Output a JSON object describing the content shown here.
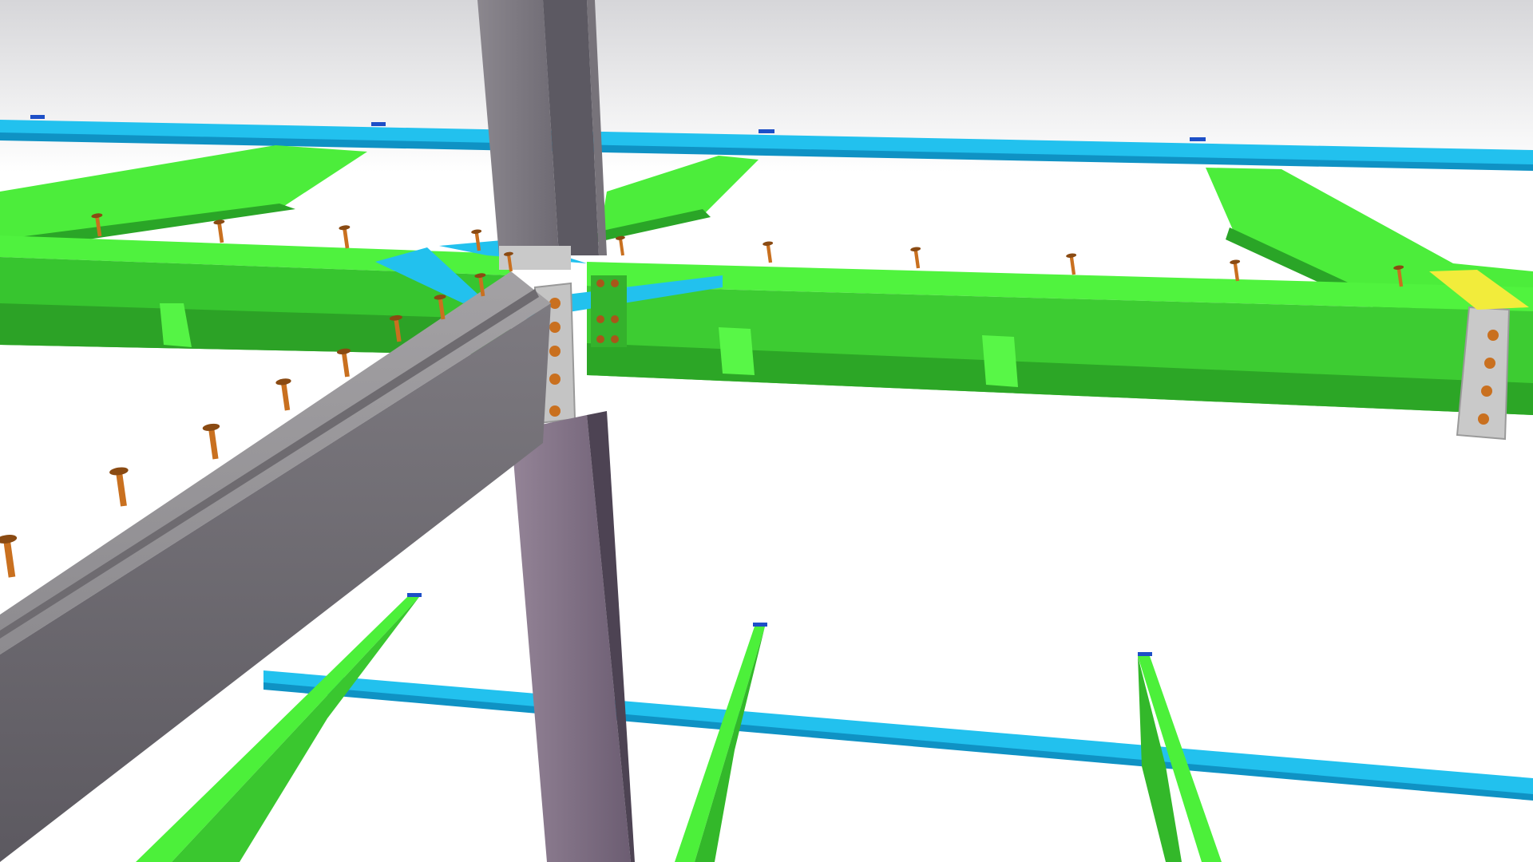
{
  "scene": {
    "kind": "3d-structural-steel-render",
    "colors": {
      "sky_top": "#d9d9dc",
      "sky_bottom": "#ffffff",
      "beam_green": "#4cf03a",
      "beam_green_dark": "#2fa828",
      "beam_green_shadow": "#239a22",
      "beam_cyan": "#22c1ee",
      "beam_cyan_dark": "#0f8fbf",
      "column_gray": "#7e7a80",
      "column_gray_dark": "#5f5b63",
      "beam_gray": "#8c8a8c",
      "plate_gray": "#c8c8c8",
      "stud_orange": "#c9701f",
      "stud_orange_dark": "#8a4a12",
      "plate_yellow": "#f2ec3b",
      "marker_blue": "#1d4fc7"
    },
    "elements": {
      "column": "steel-column",
      "main_girder": "primary-girder",
      "primary_beams": "secondary-beams",
      "purlins": "purlins",
      "connections": "bolted-end-plates",
      "shear_studs": "shear-studs"
    }
  }
}
